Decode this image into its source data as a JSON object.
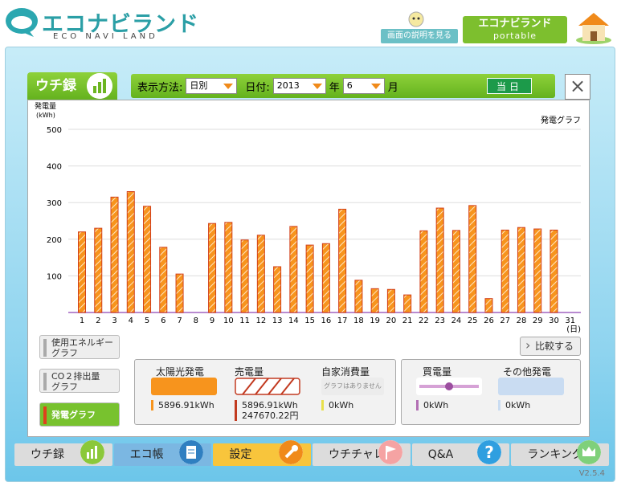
{
  "header": {
    "logo_text": "エコナビランド",
    "logo_sub": "ECO NAVI LAND",
    "help_label": "画面の説明を見る",
    "portable_line1": "エコナビランド",
    "portable_line2": "portable"
  },
  "tab": {
    "label": "ウチ録"
  },
  "controls": {
    "display_method_label": "表示方法:",
    "display_method_value": "日別",
    "date_label": "日付:",
    "year_value": "2013",
    "year_unit": "年",
    "month_value": "6",
    "month_unit": "月",
    "today_label": "当日"
  },
  "chart_data": {
    "type": "bar",
    "title": "発電グラフ",
    "ylabel": "発電量\n(kWh)",
    "xlabel": "(日)",
    "ylim": [
      0,
      500
    ],
    "yticks": [
      100,
      200,
      300,
      400,
      500
    ],
    "categories": [
      "1",
      "2",
      "3",
      "4",
      "5",
      "6",
      "7",
      "8",
      "9",
      "10",
      "11",
      "12",
      "13",
      "14",
      "15",
      "16",
      "17",
      "18",
      "19",
      "20",
      "21",
      "22",
      "23",
      "24",
      "25",
      "26",
      "27",
      "28",
      "29",
      "30",
      "31"
    ],
    "values": [
      220,
      230,
      315,
      330,
      290,
      178,
      105,
      0,
      243,
      246,
      198,
      211,
      125,
      235,
      184,
      188,
      282,
      88,
      65,
      63,
      48,
      223,
      285,
      224,
      292,
      38,
      225,
      232,
      228,
      225,
      0
    ],
    "bar_color": "#f7941d",
    "bar_stroke": "#d2401a"
  },
  "side_buttons": [
    {
      "label": "使用エネルギー\nグラフ"
    },
    {
      "label": "CO２排出量\nグラフ"
    },
    {
      "label": "発電グラフ"
    }
  ],
  "compare_label": "比較する",
  "info": {
    "solar": {
      "label": "太陽光発電",
      "value": "5896.91kWh",
      "color": "#f7941d"
    },
    "sold": {
      "label": "売電量",
      "value": "5896.91kWh",
      "yen": "247670.22円"
    },
    "self": {
      "label": "自家消費量",
      "note": "グラフはありません",
      "value": "0kWh"
    },
    "bought": {
      "label": "買電量",
      "value": "0kWh",
      "color": "#b36fb4"
    },
    "other": {
      "label": "その他発電",
      "value": "0kWh",
      "color": "#c9dcf2"
    }
  },
  "nav": [
    {
      "label": "ウチ録",
      "color": "#dcdcdc"
    },
    {
      "label": "エコ帳",
      "color": "#7bb7e2"
    },
    {
      "label": "設定",
      "color": "#f8c53c"
    },
    {
      "label": "ウチチャレ",
      "color": "#dcdcdc"
    },
    {
      "label": "Q&A",
      "color": "#dcdcdc"
    },
    {
      "label": "ランキング",
      "color": "#dcdcdc"
    }
  ],
  "version": "V2.5.4"
}
